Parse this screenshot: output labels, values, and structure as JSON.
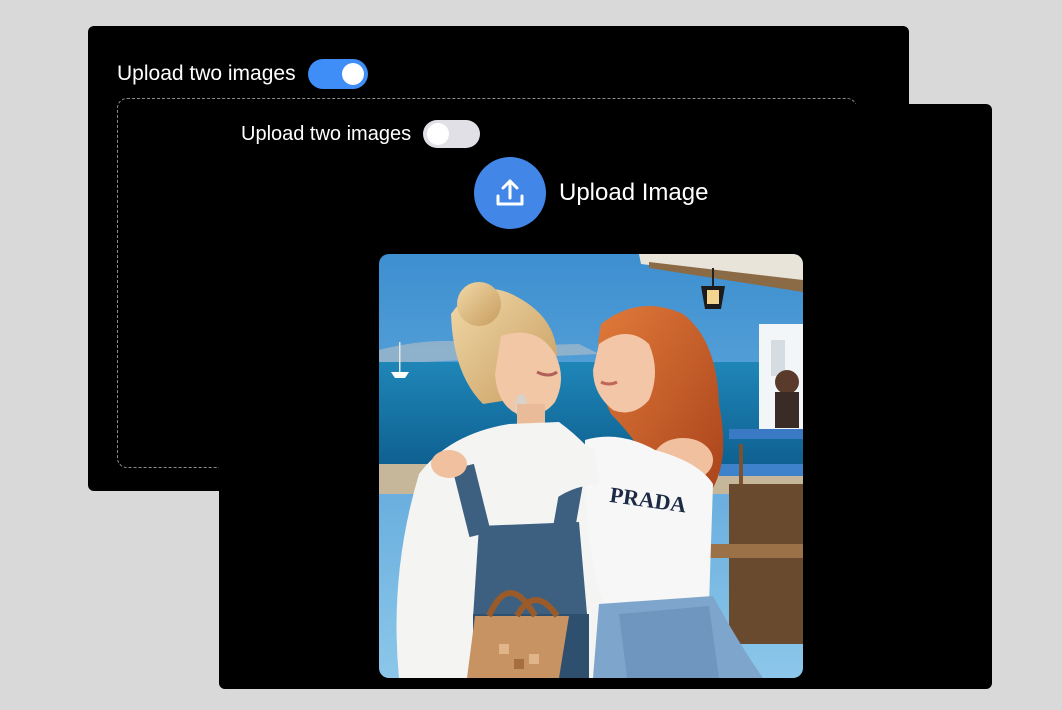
{
  "back_panel": {
    "toggle_label": "Upload two images",
    "toggle_on": true
  },
  "front_panel": {
    "toggle_label": "Upload two images",
    "toggle_on": false,
    "upload_button_label": "Upload Image",
    "upload_icon": "upload-icon",
    "photo_text": "PRADA"
  },
  "colors": {
    "toggle_on": "#3f8df7",
    "toggle_off": "#e0e0e6",
    "upload_button": "#4287e8",
    "panel_bg": "#000000",
    "page_bg": "#d9d9d9"
  }
}
